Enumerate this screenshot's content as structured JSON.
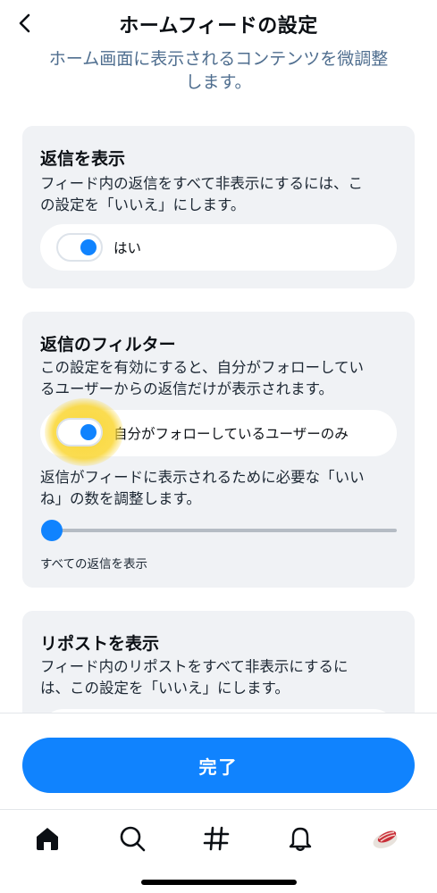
{
  "header": {
    "title": "ホームフィードの設定",
    "subtitle_line1": "ホーム画面に表示されるコンテンツを微調整",
    "subtitle_line2": "します。"
  },
  "show_replies": {
    "title": "返信を表示",
    "desc_line1": "フィード内の返信をすべて非表示にするには、こ",
    "desc_line2": "の設定を「いいえ」にします。",
    "toggle_label": "はい",
    "toggle_on": true
  },
  "reply_filter": {
    "title": "返信のフィルター",
    "desc_line1": "この設定を有効にすると、自分がフォローしてい",
    "desc_line2": "るユーザーからの返信だけが表示されます。",
    "toggle_label": "自分がフォローしているユーザーのみ",
    "toggle_on": true,
    "slider_desc_line1": "返信がフィードに表示されるために必要な「いい",
    "slider_desc_line2": "ね」の数を調整します。",
    "slider_value": 0,
    "slider_caption": "すべての返信を表示"
  },
  "show_reposts": {
    "title": "リポストを表示",
    "desc_line1": "フィード内のリポストをすべて非表示にするに",
    "desc_line2": "は、この設定を「いいえ」にします。"
  },
  "footer": {
    "done_label": "完了"
  },
  "tabbar": {
    "icons": [
      "home-icon",
      "search-icon",
      "hashtag-icon",
      "notifications-icon",
      "avatar"
    ]
  },
  "colors": {
    "accent": "#1083fe",
    "card_bg": "#f0f2f5",
    "subtitle": "#4f6e8f",
    "highlight": "#fad632"
  }
}
